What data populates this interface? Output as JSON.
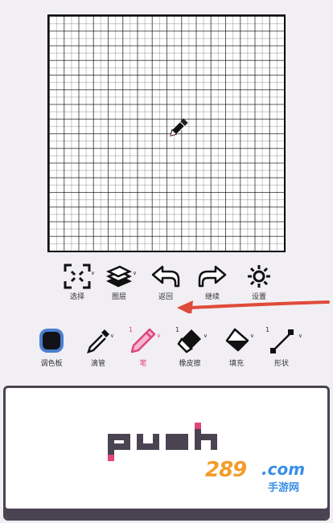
{
  "toolbar_top": {
    "items": [
      {
        "label": "选择",
        "icon": "select-frame-icon"
      },
      {
        "label": "图层",
        "icon": "layers-icon"
      },
      {
        "label": "返回",
        "icon": "undo-arrow-icon"
      },
      {
        "label": "继续",
        "icon": "redo-arrow-icon"
      },
      {
        "label": "设置",
        "icon": "gear-icon"
      }
    ]
  },
  "toolbar_bottom": {
    "items": [
      {
        "label": "调色板",
        "icon": "palette-swatch-icon"
      },
      {
        "label": "滴管",
        "icon": "eyedropper-icon"
      },
      {
        "label": "笔",
        "icon": "pencil-icon",
        "size": "1",
        "active": true
      },
      {
        "label": "橡皮擦",
        "icon": "eraser-icon",
        "size": "1"
      },
      {
        "label": "填充",
        "icon": "paint-bucket-icon"
      },
      {
        "label": "形状",
        "icon": "line-shape-icon",
        "size": "1"
      }
    ]
  },
  "preview": {
    "logo_text": "push"
  },
  "watermark": {
    "num": "289",
    "com": ".com",
    "site": "手游网"
  },
  "colors": {
    "background": "#f1eff3",
    "accent_pink": "#e0457b",
    "annotation_red": "#e04a3a",
    "frame_dark": "#4a4452",
    "palette_swatch": "#121218",
    "palette_ring": "#4a7fd0"
  }
}
